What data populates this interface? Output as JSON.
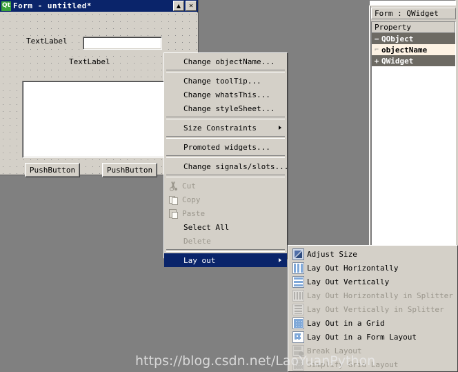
{
  "form_window": {
    "title": "Form - untitled*",
    "logo_text": "Qt",
    "titlebar_buttons": [
      {
        "name": "maximize",
        "glyph": "▲"
      },
      {
        "name": "close",
        "glyph": "✕"
      }
    ],
    "widgets": {
      "label1": "TextLabel",
      "label2": "TextLabel",
      "line_edit_value": "",
      "text_browser_value": "",
      "button1": "PushButton",
      "button2": "PushButton"
    }
  },
  "property_editor": {
    "object_header": "Form : QWidget",
    "column_header": "Property",
    "rows": [
      {
        "label": "QObject",
        "twisty": "−",
        "kind": "group"
      },
      {
        "label": "objectName",
        "twisty": "⌐",
        "kind": "item"
      },
      {
        "label": "QWidget",
        "twisty": "+",
        "kind": "group"
      }
    ]
  },
  "context_menu": {
    "items": [
      {
        "label": "Change objectName...",
        "state": "normal",
        "icon": null,
        "submenu": false
      },
      {
        "label": "__separator__"
      },
      {
        "label": "Change toolTip...",
        "state": "normal",
        "icon": null,
        "submenu": false
      },
      {
        "label": "Change whatsThis...",
        "state": "normal",
        "icon": null,
        "submenu": false
      },
      {
        "label": "Change styleSheet...",
        "state": "normal",
        "icon": null,
        "submenu": false
      },
      {
        "label": "__separator__"
      },
      {
        "label": "Size Constraints",
        "state": "normal",
        "icon": null,
        "submenu": true
      },
      {
        "label": "__separator__"
      },
      {
        "label": "Promoted widgets...",
        "state": "normal",
        "icon": null,
        "submenu": false
      },
      {
        "label": "__separator__"
      },
      {
        "label": "Change signals/slots...",
        "state": "normal",
        "icon": null,
        "submenu": false
      },
      {
        "label": "__separator__"
      },
      {
        "label": "Cut",
        "state": "disabled",
        "icon": "cut-icon",
        "submenu": false
      },
      {
        "label": "Copy",
        "state": "disabled",
        "icon": "copy-icon",
        "submenu": false
      },
      {
        "label": "Paste",
        "state": "disabled",
        "icon": "paste-icon",
        "submenu": false
      },
      {
        "label": "Select All",
        "state": "normal",
        "icon": null,
        "submenu": false
      },
      {
        "label": "Delete",
        "state": "disabled",
        "icon": null,
        "submenu": false
      },
      {
        "label": "__separator__"
      },
      {
        "label": "Lay out",
        "state": "highlight",
        "icon": null,
        "submenu": true
      }
    ]
  },
  "layout_submenu": {
    "items": [
      {
        "label": "Adjust Size",
        "state": "normal",
        "icon": "adjust-size-icon"
      },
      {
        "label": "Lay Out Horizontally",
        "state": "normal",
        "icon": "layout-horizontal-icon"
      },
      {
        "label": "Lay Out Vertically",
        "state": "normal",
        "icon": "layout-vertical-icon"
      },
      {
        "label": "Lay Out Horizontally in Splitter",
        "state": "disabled",
        "icon": "splitter-horizontal-icon"
      },
      {
        "label": "Lay Out Vertically in Splitter",
        "state": "disabled",
        "icon": "splitter-vertical-icon"
      },
      {
        "label": "Lay Out in a Grid",
        "state": "normal",
        "icon": "layout-grid-icon"
      },
      {
        "label": "Lay Out in a Form Layout",
        "state": "normal",
        "icon": "layout-form-icon"
      },
      {
        "label": "Break Layout",
        "state": "disabled",
        "icon": "break-layout-icon"
      },
      {
        "label": "Simplify Grid Layout",
        "state": "disabled",
        "icon": "simplify-grid-icon"
      }
    ]
  },
  "watermark": {
    "text": "https://blog.csdn.net/LaoYuanPython"
  },
  "colors": {
    "titlebar": "#0a246a",
    "menu_face": "#d4d0c8",
    "workspace": "#808080",
    "highlight": "#0a246a",
    "prop_group": "#6d6a63",
    "prop_item": "#fdf2e3"
  }
}
